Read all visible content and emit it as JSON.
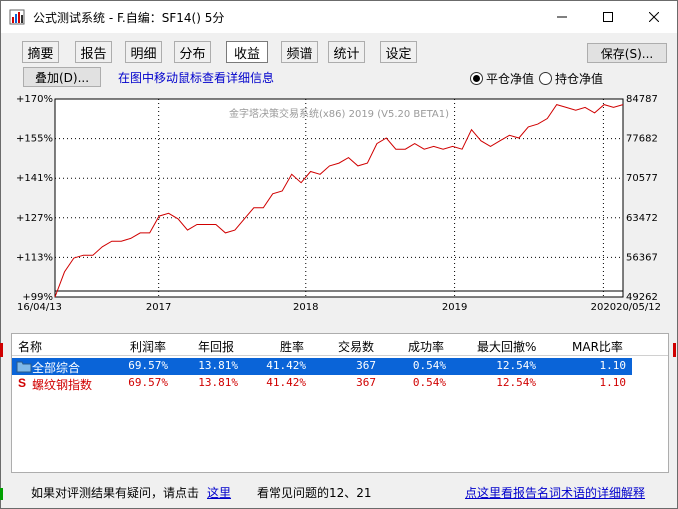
{
  "window": {
    "title": "公式测试系统 - F.自编：SF14() 5分"
  },
  "tabs": [
    {
      "label": "摘要"
    },
    {
      "label": "报告"
    },
    {
      "label": "明细"
    },
    {
      "label": "分布"
    },
    {
      "label": "收益",
      "active": true
    },
    {
      "label": "频谱"
    },
    {
      "label": "统计"
    },
    {
      "label": "设定"
    }
  ],
  "toolbar": {
    "save_label": "保存(S)...",
    "overlay_label": "叠加(D)...",
    "hint_text": "在图中移动鼠标查看详细信息",
    "radio_close": "平仓净值",
    "radio_hold": "持仓净值",
    "radio_selected": "平仓净值"
  },
  "chart_data": {
    "type": "line",
    "watermark": "金字塔决策交易系统(x86) 2019 (V5.20 BETA1)",
    "left_axis_ticks": [
      "+170%",
      "+155%",
      "+141%",
      "+127%",
      "+113%",
      "+99%"
    ],
    "right_axis_ticks": [
      "84787",
      "77682",
      "70577",
      "63472",
      "56367",
      "49262"
    ],
    "x_labels": [
      "16/04/13",
      "2017",
      "2018",
      "2019",
      "2020",
      "20/05/12"
    ],
    "ylim": [
      99,
      170
    ],
    "grid": true,
    "line_color": "#d00000",
    "x": [
      0,
      1,
      2,
      3,
      4,
      5,
      6,
      7,
      8,
      9,
      10,
      11,
      12,
      13,
      14,
      15,
      16,
      17,
      18,
      19,
      20,
      21,
      22,
      23,
      24,
      25,
      26,
      27,
      28,
      29,
      30,
      31,
      32,
      33,
      34,
      35,
      36,
      37,
      38,
      39,
      40,
      41,
      42,
      43,
      44,
      45,
      46,
      47,
      48,
      49,
      50,
      51,
      52,
      53,
      54,
      55,
      56,
      57,
      58,
      59,
      60
    ],
    "values": [
      99,
      108,
      113,
      114,
      114,
      117,
      119,
      119,
      120,
      122,
      122,
      128,
      129,
      127,
      123,
      125,
      125,
      125,
      122,
      123,
      127,
      131,
      131,
      136,
      137,
      143,
      140,
      144,
      143,
      146,
      147,
      149,
      146,
      147,
      154,
      156,
      152,
      152,
      154,
      152,
      153,
      152,
      153,
      152,
      159,
      155,
      153,
      155,
      157,
      156,
      160,
      161,
      163,
      168,
      167,
      166,
      167,
      165,
      168,
      167,
      168
    ]
  },
  "table": {
    "headers": [
      "名称",
      "利润率",
      "年回报",
      "胜率",
      "交易数",
      "成功率",
      "最大回撤%",
      "MAR比率"
    ],
    "rows": [
      {
        "icon": "folder-icon",
        "name": "全部综合",
        "cells": [
          "69.57%",
          "13.81%",
          "41.42%",
          "367",
          "0.54%",
          "12.54%",
          "1.10"
        ],
        "selected": true
      },
      {
        "icon": "S",
        "name": "螺纹钢指数",
        "cells": [
          "69.57%",
          "13.81%",
          "41.42%",
          "367",
          "0.54%",
          "12.54%",
          "1.10"
        ],
        "selected": false
      }
    ]
  },
  "footer": {
    "question_text": "如果对评测结果有疑问，请点击",
    "here_link": "这里",
    "faq_text": "看常见问题的12、21",
    "glossary_link": "点这里看报告名词术语的详细解释"
  },
  "colors": {
    "accent": "#0a64d8",
    "link": "#0000cc",
    "equity_line": "#d00000"
  }
}
